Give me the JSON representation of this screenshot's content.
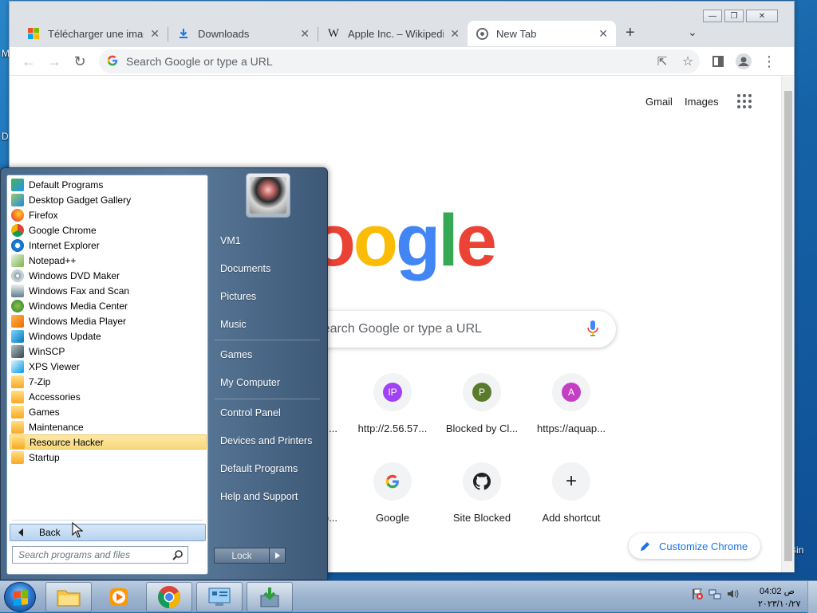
{
  "desktop": {
    "left_label_1": "M",
    "left_label_2": "D",
    "recycle_bin_label": "Bin"
  },
  "chrome": {
    "tabs": [
      {
        "title": "Télécharger une image",
        "icon": "windows-logo-icon"
      },
      {
        "title": "Downloads",
        "icon": "download-icon"
      },
      {
        "title": "Apple Inc. – Wikipedia",
        "icon": "wikipedia-icon"
      },
      {
        "title": "New Tab",
        "icon": "chrome-icon",
        "active": true
      }
    ],
    "omnibox_placeholder": "Search Google or type a URL",
    "ntp": {
      "gmail": "Gmail",
      "images": "Images",
      "search_placeholder": "Search Google or type a URL",
      "shortcuts_row1": [
        {
          "label": "http://2.56.57...",
          "letter": "IP",
          "color": "#a142f4"
        },
        {
          "label": "Blocked by Cl...",
          "letter": "P",
          "color": "#5b7b2c"
        },
        {
          "label": "https://aquap...",
          "letter": "A",
          "color": "#c43fc4"
        }
      ],
      "shortcuts_row2": [
        {
          "label": "Google",
          "icon": "google-g-icon"
        },
        {
          "label": "Site Blocked",
          "icon": "github-icon"
        },
        {
          "label": "Add shortcut",
          "icon": "plus-icon"
        }
      ],
      "partial_left_row1": "...",
      "partial_left_row2": "o...",
      "customize": "Customize Chrome"
    }
  },
  "start_menu": {
    "programs": [
      "Default Programs",
      "Desktop Gadget Gallery",
      "Firefox",
      "Google Chrome",
      "Internet Explorer",
      "Notepad++",
      "Windows DVD Maker",
      "Windows Fax and Scan",
      "Windows Media Center",
      "Windows Media Player",
      "Windows Update",
      "WinSCP",
      "XPS Viewer",
      "7-Zip",
      "Accessories",
      "Games",
      "Maintenance",
      "Resource Hacker",
      "Startup"
    ],
    "selected_program": "Resource Hacker",
    "back_label": "Back",
    "search_placeholder": "Search programs and files",
    "right_links": [
      "VM1",
      "Documents",
      "Pictures",
      "Music",
      "Games",
      "My Computer",
      "Control Panel",
      "Devices and Printers",
      "Default Programs",
      "Help and Support"
    ],
    "lock_label": "Lock"
  },
  "taskbar": {
    "time": "04:02 ص",
    "date": "٢٠٢٣/١٠/٢٧"
  }
}
